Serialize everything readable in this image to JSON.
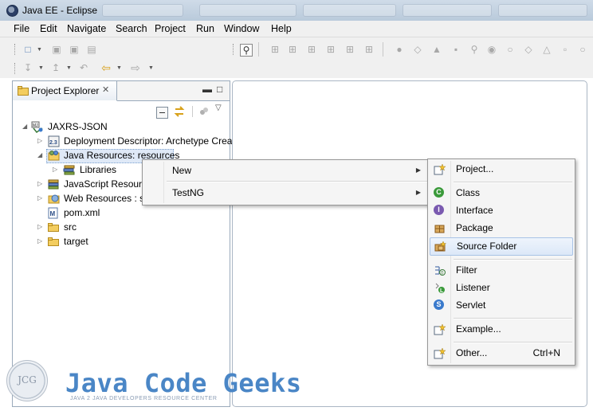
{
  "window": {
    "title": "Java EE - Eclipse"
  },
  "menubar": [
    "File",
    "Edit",
    "Navigate",
    "Search",
    "Project",
    "Run",
    "Window",
    "Help"
  ],
  "view": {
    "tab_label": "Project Explorer"
  },
  "tree": [
    {
      "label": "JAXRS-JSON",
      "icon": "web-project-icon",
      "expanded": true
    },
    {
      "label": "Deployment Descriptor: Archetype Crea",
      "icon": "deployment-descriptor-icon"
    },
    {
      "label": "Java Resources: resources",
      "icon": "java-resources-icon",
      "expanded": true,
      "selected": true
    },
    {
      "label": "Libraries",
      "icon": "libraries-icon"
    },
    {
      "label": "JavaScript Resourc",
      "icon": "javascript-resources-icon"
    },
    {
      "label": "Web Resources : sr",
      "icon": "web-resources-icon"
    },
    {
      "label": "pom.xml",
      "icon": "maven-pom-icon"
    },
    {
      "label": "src",
      "icon": "folder-icon"
    },
    {
      "label": "target",
      "icon": "folder-icon"
    }
  ],
  "context_menu": [
    {
      "label": "New",
      "has_submenu": true
    },
    {
      "label": "TestNG",
      "has_submenu": true
    }
  ],
  "submenu": [
    {
      "label": "Project...",
      "icon": "new-project-icon"
    },
    {
      "label": "Class",
      "icon": "class-icon"
    },
    {
      "label": "Interface",
      "icon": "interface-icon"
    },
    {
      "label": "Package",
      "icon": "package-icon"
    },
    {
      "label": "Source Folder",
      "icon": "source-folder-icon",
      "highlighted": true
    },
    {
      "label": "Filter",
      "icon": "filter-icon"
    },
    {
      "label": "Listener",
      "icon": "listener-icon"
    },
    {
      "label": "Servlet",
      "icon": "servlet-icon"
    },
    {
      "label": "Example...",
      "icon": "example-icon"
    },
    {
      "label": "Other...",
      "icon": "other-icon",
      "accelerator": "Ctrl+N"
    }
  ],
  "watermark": {
    "seal": "JCG",
    "title": "Java Code Geeks",
    "subtitle": "JAVA 2 JAVA DEVELOPERS RESOURCE CENTER"
  },
  "colors": {
    "selection": "#dfe9f7",
    "menu_highlight": "#dce8f8",
    "watermark": "#4a86c6"
  }
}
